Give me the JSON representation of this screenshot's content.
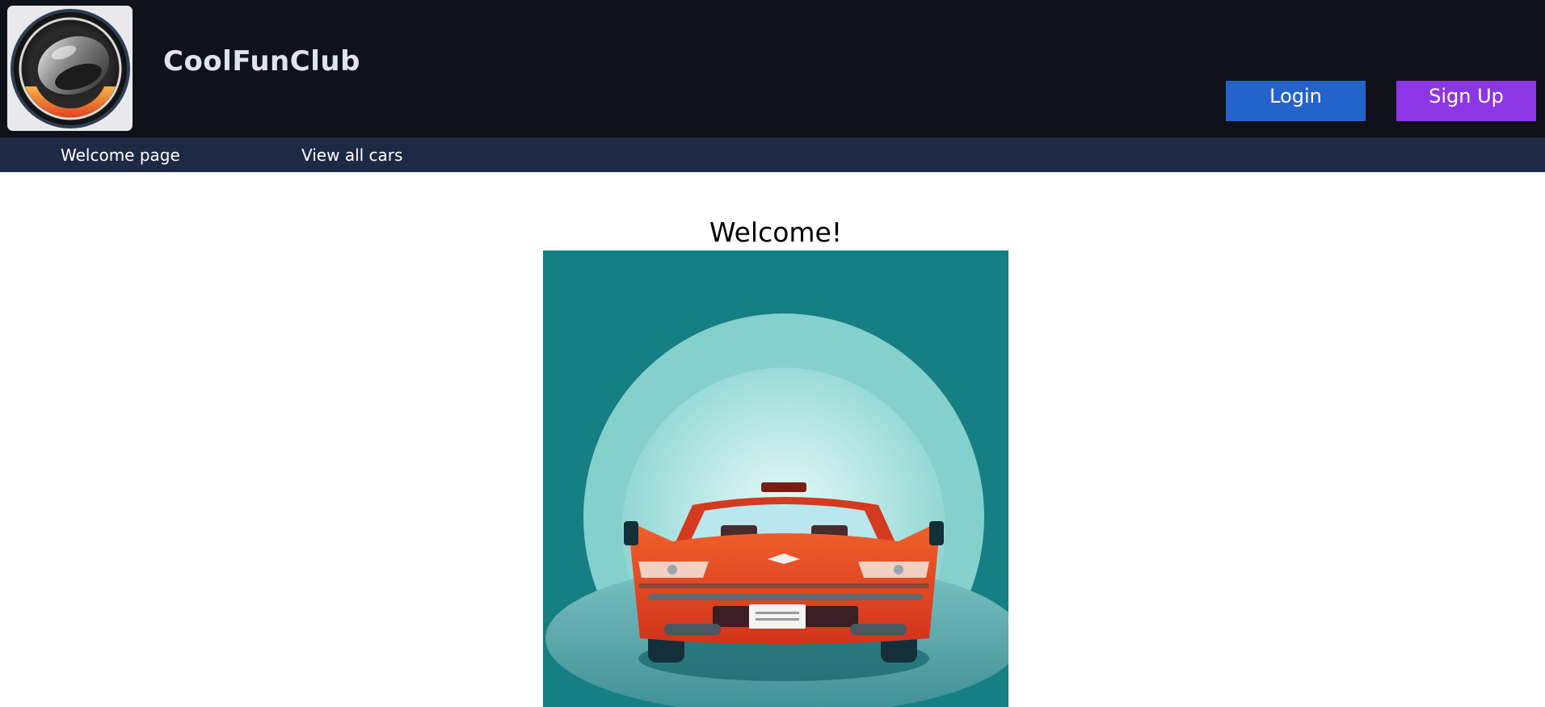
{
  "header": {
    "logo_icon": "wheel-logo-icon",
    "brand_name": "CoolFunClub",
    "login_label": "Login",
    "signup_label": "Sign Up",
    "colors": {
      "background": "#0f121a",
      "login": "#2563cc",
      "signup": "#8c36e6"
    }
  },
  "nav": {
    "items": [
      {
        "label": "Welcome page"
      },
      {
        "label": "View all cars"
      }
    ],
    "background": "#1e2a44"
  },
  "main": {
    "title": "Welcome!",
    "hero_image": "red-sports-car-rear-illustration"
  }
}
